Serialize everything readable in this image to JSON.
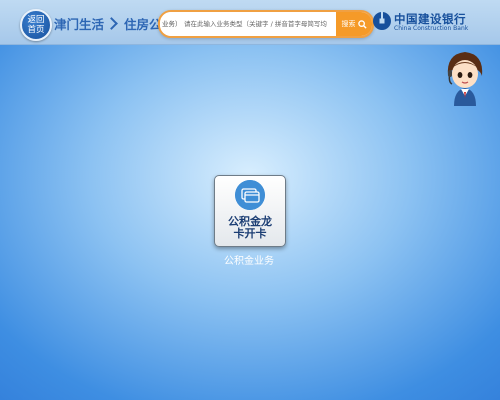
{
  "header": {
    "home_button": {
      "line1": "返回",
      "line2": "首页"
    },
    "breadcrumb": [
      "津门生活",
      "住房公积金"
    ],
    "search": {
      "partial_text": "业务）",
      "placeholder": "请在此输入业务类型（关键字 / 拼音首字母简写均",
      "button_label": "搜索"
    },
    "bank": {
      "name_cn": "中国建设银行",
      "name_en": "China Construction Bank",
      "brand_color": "#17509c"
    }
  },
  "main": {
    "tile": {
      "label_line1": "公积金龙",
      "label_line2": "卡开卡",
      "icon": "card-icon"
    },
    "caption": "公积金业务"
  },
  "colors": {
    "accent": "#f59a28",
    "primary": "#2d66b4"
  }
}
